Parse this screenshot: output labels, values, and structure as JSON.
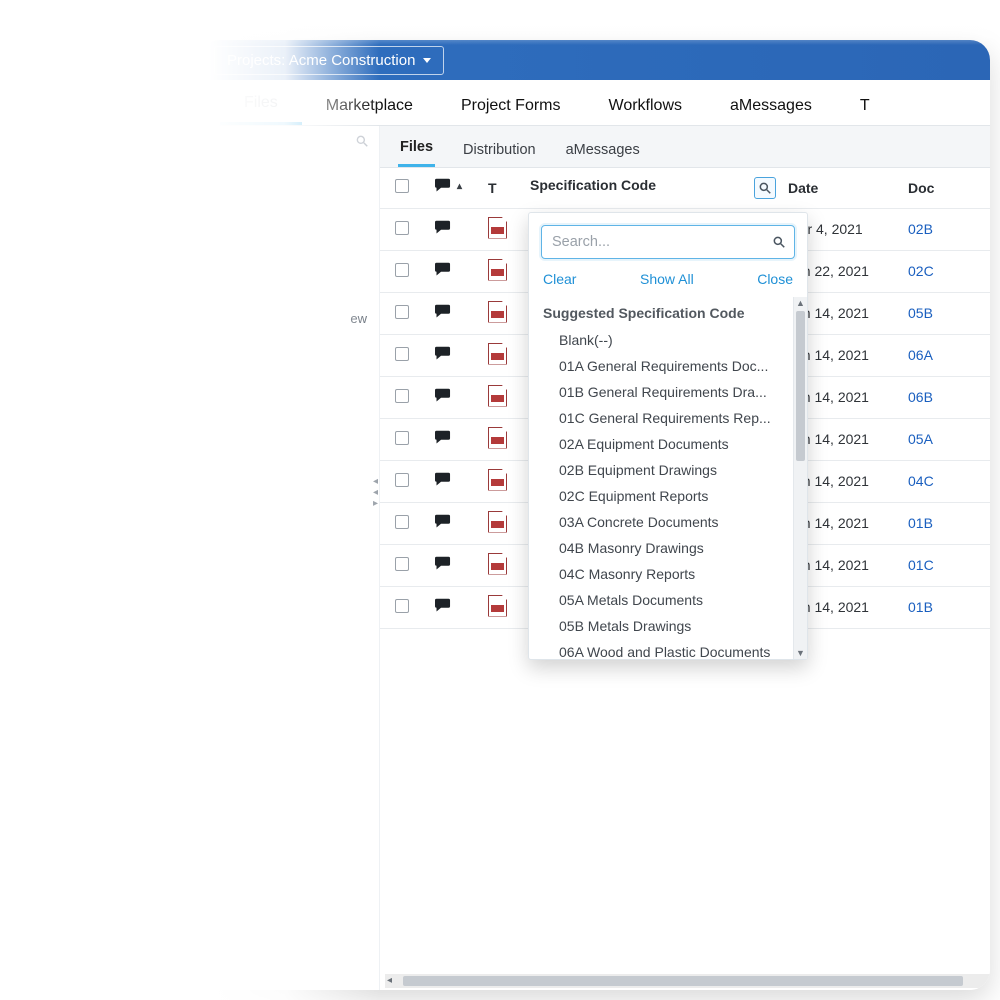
{
  "title_bar": {
    "project_selector_label": "Projects: Acme Construction"
  },
  "main_tabs": [
    {
      "label": "Files",
      "active": true
    },
    {
      "label": "Marketplace"
    },
    {
      "label": "Project Forms"
    },
    {
      "label": "Workflows"
    },
    {
      "label": "aMessages"
    },
    {
      "label": "T"
    }
  ],
  "sub_tabs": [
    {
      "label": "Files",
      "active": true
    },
    {
      "label": "Distribution"
    },
    {
      "label": "aMessages"
    }
  ],
  "sidebar": {
    "new_label": "ew"
  },
  "table": {
    "columns": {
      "t": "T",
      "spec": "Specification Code",
      "date": "Date",
      "doc": "Doc"
    },
    "rows": [
      {
        "date": "Mar 4, 2021",
        "doc": "02B"
      },
      {
        "date": "Jan 22, 2021",
        "doc": "02C"
      },
      {
        "date": "Jan 14, 2021",
        "doc": "05B"
      },
      {
        "date": "Jan 14, 2021",
        "doc": "06A"
      },
      {
        "date": "Jan 14, 2021",
        "doc": "06B"
      },
      {
        "date": "Jan 14, 2021",
        "doc": "05A"
      },
      {
        "date": "Jan 14, 2021",
        "doc": "04C"
      },
      {
        "date": "Jan 14, 2021",
        "doc": "01B"
      },
      {
        "date": "Jan 14, 2021",
        "doc": "01C"
      },
      {
        "date": "Jan 14, 2021",
        "doc": "01B"
      }
    ]
  },
  "filter_popover": {
    "search_placeholder": "Search...",
    "clear": "Clear",
    "show_all": "Show All",
    "close": "Close",
    "heading": "Suggested Specification Code",
    "items": [
      "Blank(--)",
      "01A General Requirements Doc...",
      "01B General Requirements Dra...",
      "01C General Requirements Rep...",
      "02A Equipment Documents",
      "02B Equipment Drawings",
      "02C Equipment Reports",
      "03A Concrete Documents",
      "04B Masonry Drawings",
      "04C Masonry Reports",
      "05A Metals Documents",
      "05B Metals Drawings",
      "06A Wood and Plastic Documents"
    ]
  }
}
